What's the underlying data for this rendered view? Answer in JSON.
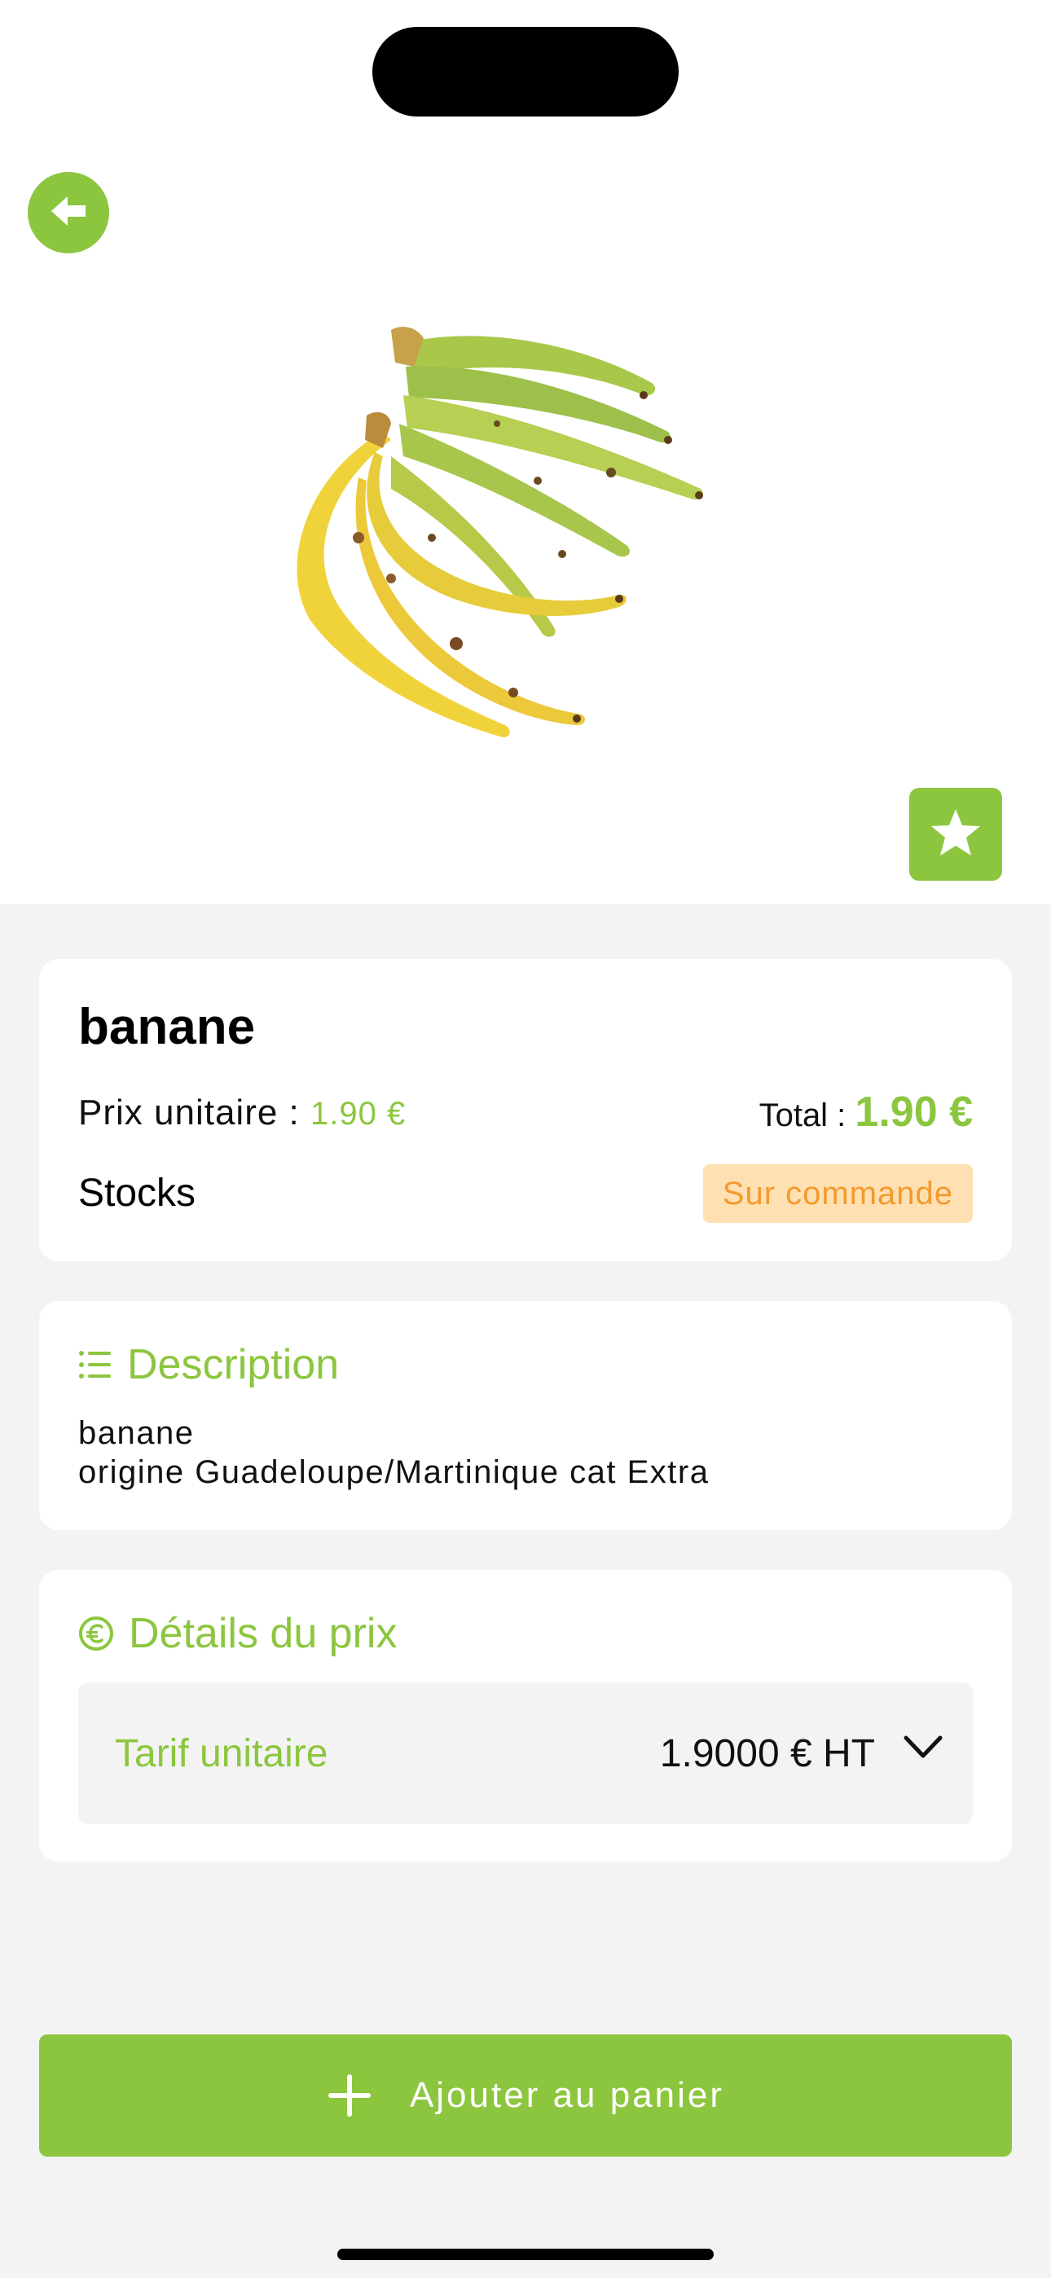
{
  "product": {
    "name": "banane",
    "unit_price_label": "Prix unitaire : ",
    "unit_price_value": "1.90 €",
    "total_label": "Total : ",
    "total_value": "1.90 €",
    "stocks_label": "Stocks",
    "stock_status": "Sur commande"
  },
  "description": {
    "title": "Description",
    "line1": "banane",
    "line2": "origine Guadeloupe/Martinique cat Extra"
  },
  "price_details": {
    "title": "Détails du prix",
    "tarif_label": "Tarif unitaire",
    "tarif_value": "1.9000 € HT"
  },
  "actions": {
    "add_to_cart": "Ajouter au panier"
  },
  "icons": {
    "back": "arrow-left-icon",
    "favorite": "star-icon",
    "description": "list-icon",
    "price": "euro-circle-icon",
    "tarif": "chevron-down-icon",
    "add": "plus-icon"
  },
  "colors": {
    "accent": "#8cc63f",
    "badge_bg": "#ffe0b2",
    "badge_text": "#f39a2c",
    "background": "#f3f3f3"
  }
}
